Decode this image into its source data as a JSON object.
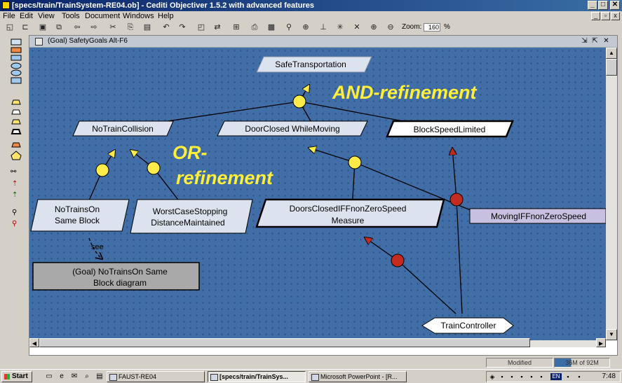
{
  "window": {
    "title": "[specs/train/TrainSystem-RE04.ob] - Cediti Objectiver 1.5.2 with advanced features",
    "min": "_",
    "max": "□",
    "close": "✕"
  },
  "menu": [
    "File",
    "Edit",
    "View",
    "Tools",
    "Document",
    "Windows",
    "Help"
  ],
  "toolbar": {
    "zoom_label": "Zoom:",
    "zoom_value": "160",
    "zoom_unit": "%"
  },
  "child_window": {
    "title": "(Goal) SafetyGoals  Alt-F6"
  },
  "diagram": {
    "goals": {
      "safe_transportation": "SafeTransportation",
      "no_train_collision": "NoTrainCollision",
      "door_closed": "DoorClosed WhileMoving",
      "block_speed": "BlockSpeedLimited",
      "no_trains_on_1": "NoTrainsOn",
      "no_trains_on_2": "Same Block",
      "worst_case_1": "WorstCaseStopping",
      "worst_case_2": "DistanceMaintained",
      "doors_closed_1": "DoorsClosedIFFnonZeroSpeed",
      "doors_closed_2": "Measure",
      "moving_iff": "MovingIFFnonZeroSpeed",
      "goal_ref_1": "(Goal) NoTrainsOn Same",
      "goal_ref_2": "Block diagram"
    },
    "agent": "TrainController",
    "see_label": "see",
    "annotation_and": "AND-refinement",
    "annotation_or_1": "OR-",
    "annotation_or_2": "refinement"
  },
  "status": {
    "modified": "Modified",
    "memory": "36M of 92M"
  },
  "taskbar": {
    "start": "Start",
    "tasks": [
      "FAUST-RE04",
      "[specs/train/TrainSys...",
      "Microsoft PowerPoint - [R..."
    ],
    "lang": "EN",
    "clock": "7:48"
  },
  "colors": {
    "canvas": "#416ea6",
    "goal_fill": "#dde3ee",
    "requirement_fill": "#c8c0e0",
    "and_node": "#ffec4a",
    "agent_node": "#c42a1e",
    "annotation": "#ffef3a",
    "title_bar": "#0a246a"
  }
}
